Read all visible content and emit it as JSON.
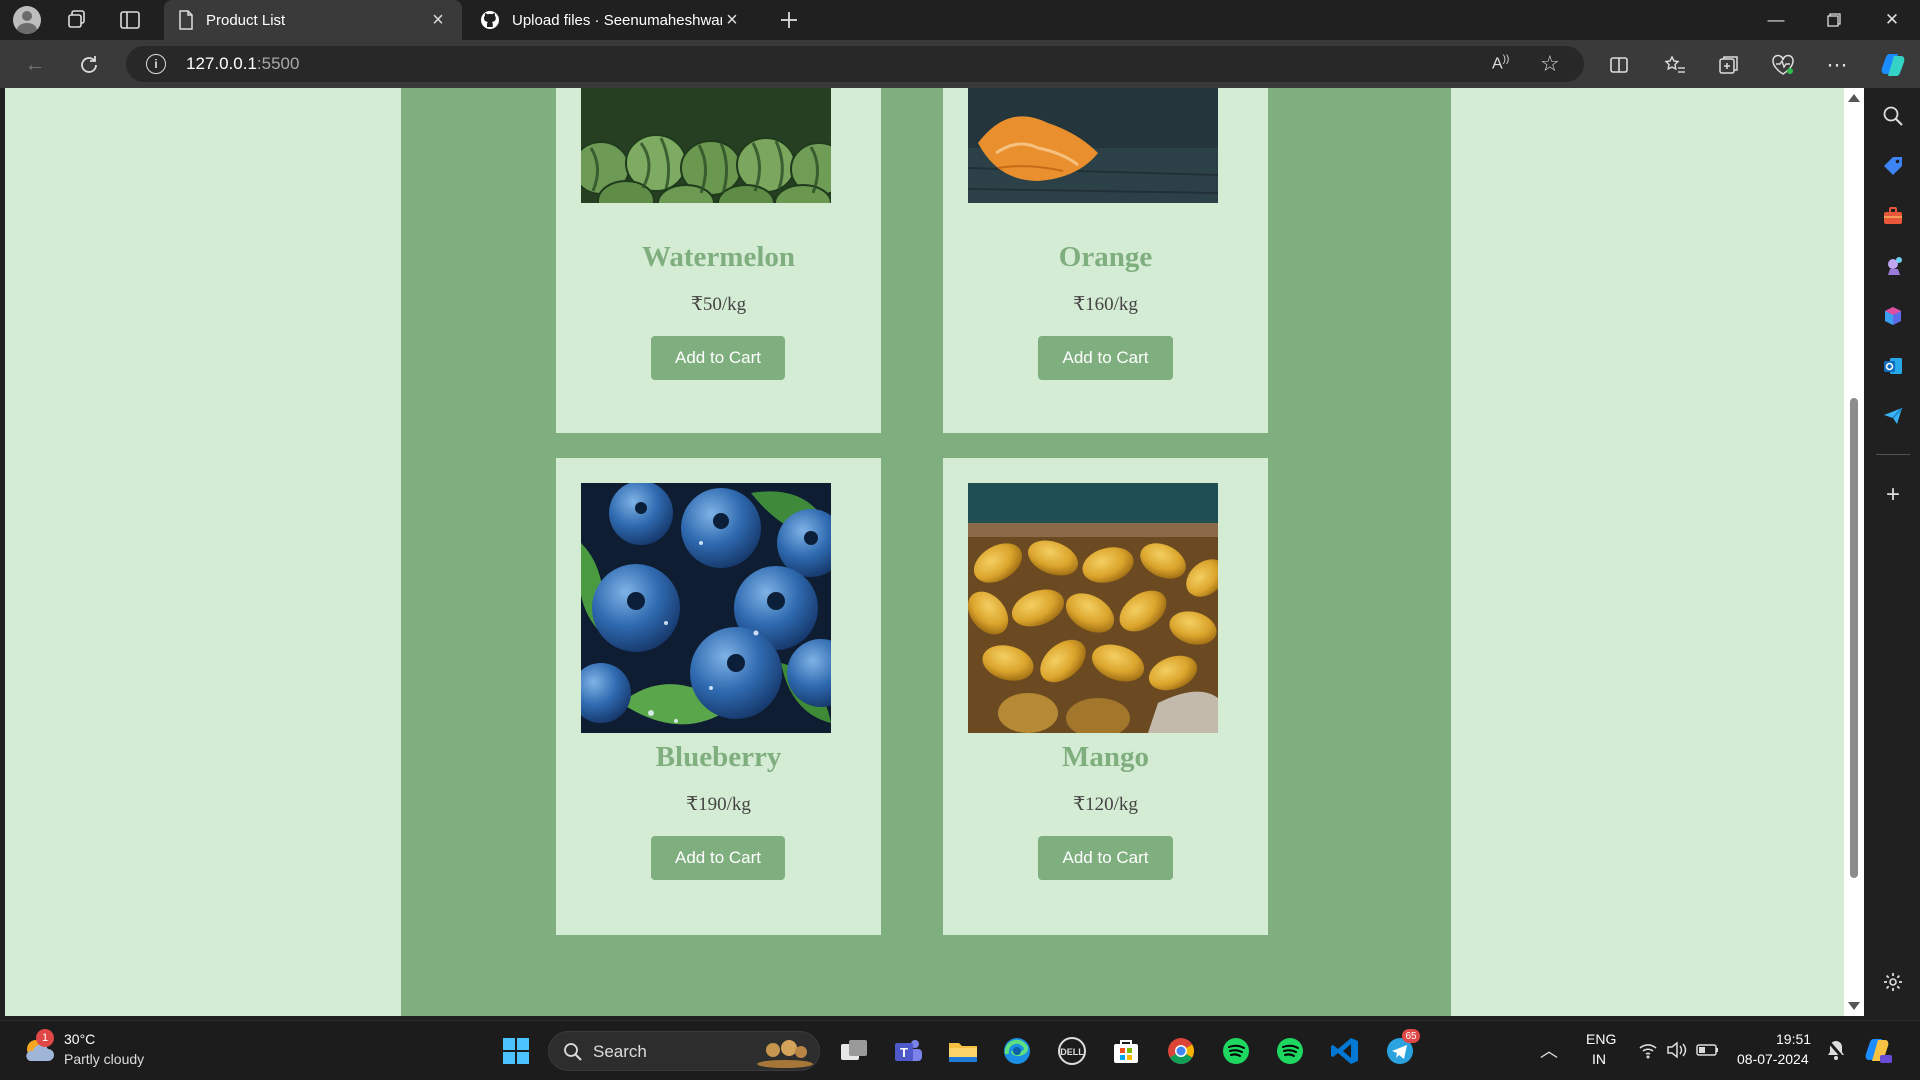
{
  "browser": {
    "tabs": [
      {
        "label": "Product List",
        "active": true
      },
      {
        "label": "Upload files · Seenumaheshwaran",
        "active": false
      }
    ],
    "url_host": "127.0.0.1",
    "url_port": ":5500"
  },
  "products": [
    {
      "name": "Watermelon",
      "price": "₹50/kg",
      "button": "Add to Cart",
      "image": "watermelon"
    },
    {
      "name": "Orange",
      "price": "₹160/kg",
      "button": "Add to Cart",
      "image": "orange"
    },
    {
      "name": "Blueberry",
      "price": "₹190/kg",
      "button": "Add to Cart",
      "image": "blueberry"
    },
    {
      "name": "Mango",
      "price": "₹120/kg",
      "button": "Add to Cart",
      "image": "mango"
    }
  ],
  "taskbar": {
    "weather_temp": "30°C",
    "weather_desc": "Partly cloudy",
    "weather_badge": "1",
    "search_label": "Search",
    "telegram_badge": "65",
    "lang_top": "ENG",
    "lang_bottom": "IN",
    "time": "19:51",
    "date": "08-07-2024"
  },
  "colors": {
    "page_bg": "#d5ecd4",
    "content_bg": "#7fae7f",
    "accent_green": "#7fae7f"
  }
}
